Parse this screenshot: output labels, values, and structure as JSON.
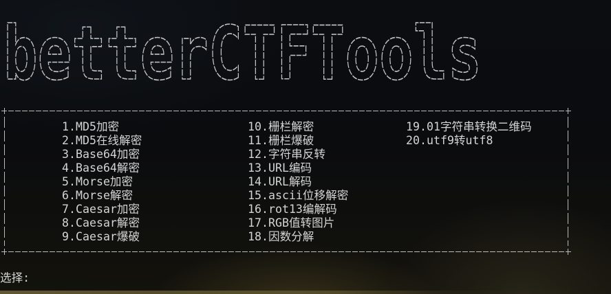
{
  "banner": {
    "text": "betterCTFTools"
  },
  "menu": {
    "columns": [
      {
        "items": [
          "1.MD5加密",
          "2.MD5在线解密",
          "3.Base64加密",
          "4.Base64解密",
          "5.Morse加密",
          "6.Morse解密",
          "7.Caesar加密",
          "8.Caesar解密",
          "9.Caesar爆破"
        ]
      },
      {
        "items": [
          "10.栅栏解密",
          "11.栅栏爆破",
          "12.字符串反转",
          "13.URL编码",
          "14.URL解码",
          "15.ascii位移解密",
          "16.rot13编解码",
          "17.RGB值转图片",
          "18.因数分解"
        ]
      },
      {
        "items": [
          "19.01字符串转换二维码",
          "20.utf9转utf8"
        ]
      }
    ]
  },
  "prompt": {
    "label": "选择:",
    "input_value": ""
  },
  "colors": {
    "background": "#0b0c0e",
    "text": "#d4d4d4",
    "banner": "#c4c4c4",
    "border": "#bcbcbc"
  }
}
